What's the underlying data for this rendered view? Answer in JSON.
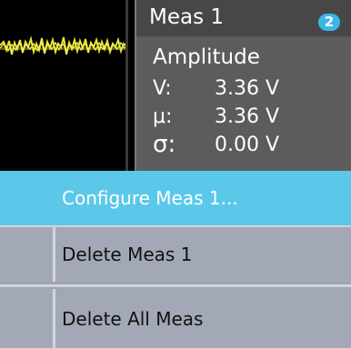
{
  "measurement": {
    "title": "Meas 1",
    "channel": "2",
    "channel_color": "#39b7e5",
    "type": "Amplitude",
    "rows": [
      {
        "label": "V:",
        "value": "3.36 V"
      },
      {
        "label": "μ:",
        "value": "3.36 V"
      },
      {
        "label": "σ:",
        "value": "0.00 V"
      }
    ]
  },
  "waveform": {
    "trace_color": "#e8e832"
  },
  "context_menu": {
    "items": [
      {
        "label": "Configure Meas 1..."
      },
      {
        "label": "Delete Meas 1"
      },
      {
        "label": "Delete All Meas"
      }
    ]
  }
}
